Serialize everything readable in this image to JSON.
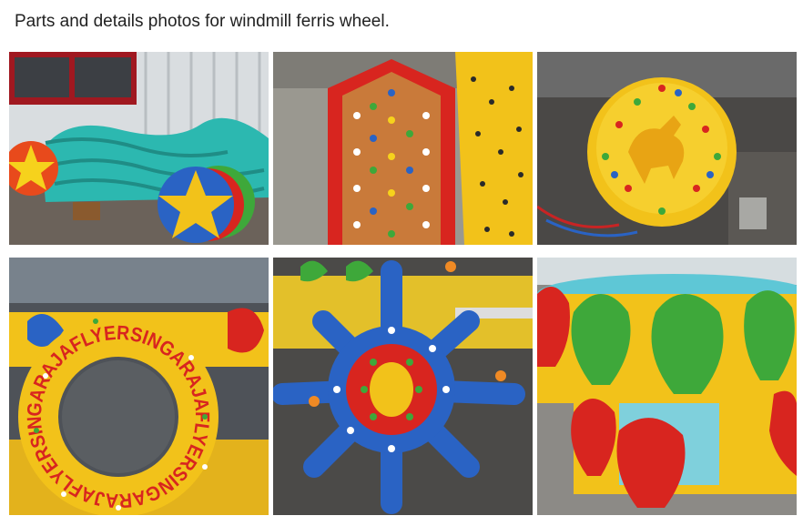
{
  "caption": "Parts and details photos for windmill ferris wheel.",
  "ring_text": "GARAJAFLYERSINGARAJAFLYERSINGARAJAFLYERSIN",
  "photos": [
    {
      "subject": "teal fish parts and star discs"
    },
    {
      "subject": "red panel with bulbs"
    },
    {
      "subject": "yellow disc with horse emblem"
    },
    {
      "subject": "yellow ring with red lettering"
    },
    {
      "subject": "blue sun hub with lights"
    },
    {
      "subject": "cabin with green and red leaves"
    }
  ],
  "colors": {
    "yellow": "#f2c21a",
    "red": "#d8251f",
    "blue": "#2a63c4",
    "teal": "#2cb8b0",
    "green": "#3ea83a"
  }
}
